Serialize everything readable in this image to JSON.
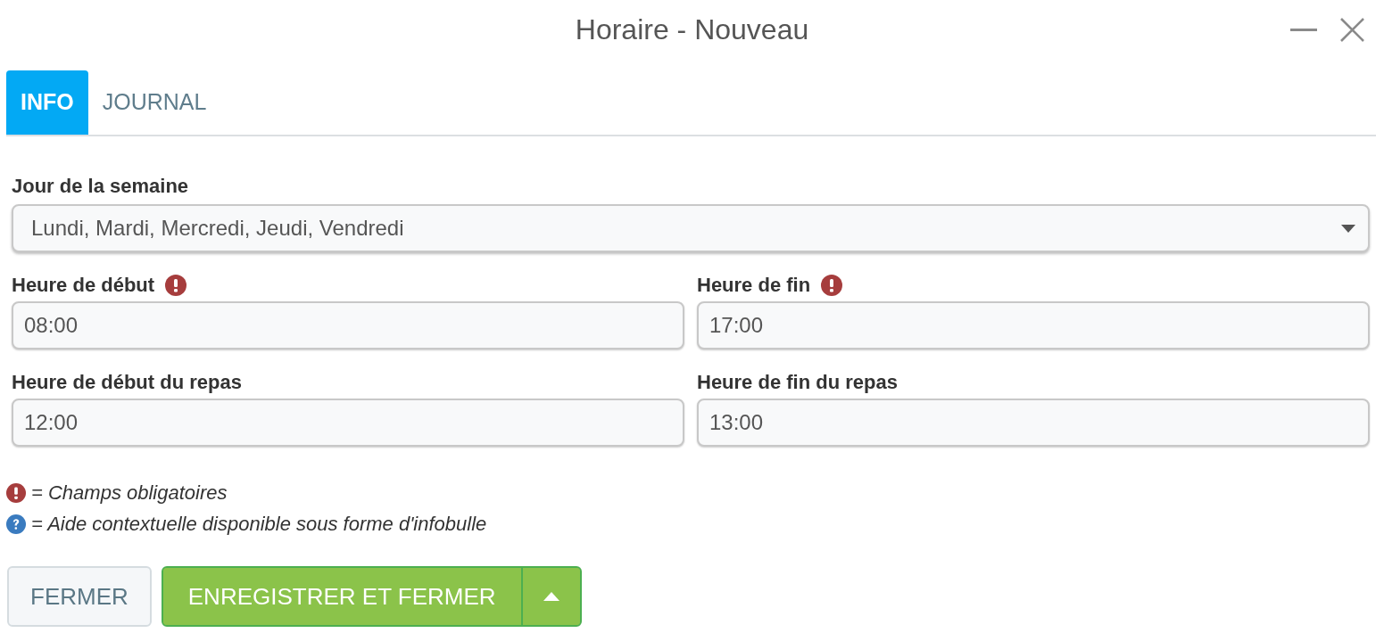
{
  "window": {
    "title": "Horaire - Nouveau"
  },
  "tabs": [
    {
      "label": "INFO",
      "selected": true
    },
    {
      "label": "JOURNAL",
      "selected": false
    }
  ],
  "weekday": {
    "label": "Jour de la semaine",
    "value": "Lundi, Mardi, Mercredi, Jeudi, Vendredi"
  },
  "fields": [
    {
      "label": "Heure de début",
      "required": true,
      "value": "08:00"
    },
    {
      "label": "Heure de fin",
      "required": true,
      "value": "17:00"
    },
    {
      "label": "Heure de début du repas",
      "required": false,
      "value": "12:00"
    },
    {
      "label": "Heure de fin du repas",
      "required": false,
      "value": "13:00"
    }
  ],
  "legend": [
    {
      "kind": "required",
      "text": "= Champs obligatoires"
    },
    {
      "kind": "help",
      "text": "= Aide contextuelle disponible sous forme d'infobulle"
    }
  ],
  "buttons": {
    "close": "FERMER",
    "save": "ENREGISTRER ET FERMER"
  }
}
